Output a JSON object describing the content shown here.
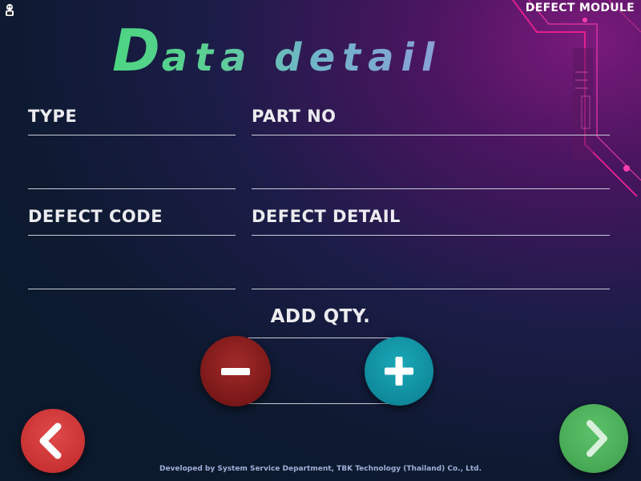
{
  "header": {
    "module_title": "DEFECT MODULE",
    "page_title_initial": "D",
    "page_title_rest": "ata detail"
  },
  "fields": {
    "type": {
      "label": "TYPE",
      "value": ""
    },
    "part_no": {
      "label": "PART NO",
      "value": ""
    },
    "defect_code": {
      "label": "DEFECT CODE",
      "value": ""
    },
    "defect_detail": {
      "label": "DEFECT DETAIL",
      "value": ""
    }
  },
  "quantity": {
    "label": "ADD QTY.",
    "value": ""
  },
  "buttons": {
    "decrease_icon": "minus-icon",
    "increase_icon": "plus-icon",
    "back_icon": "chevron-left-icon",
    "next_icon": "chevron-right-icon"
  },
  "footer": {
    "credit": "Developed by System Service Department, TBK Technology (Thailand) Co., Ltd."
  },
  "colors": {
    "title_gradient_start": "#4cd582",
    "title_gradient_end": "#8aa0d6",
    "decrease_button": "#7a1818",
    "increase_button": "#0f8a9b",
    "back_button": "#c93232",
    "next_button": "#48a955",
    "accent_magenta": "#e0208f"
  }
}
